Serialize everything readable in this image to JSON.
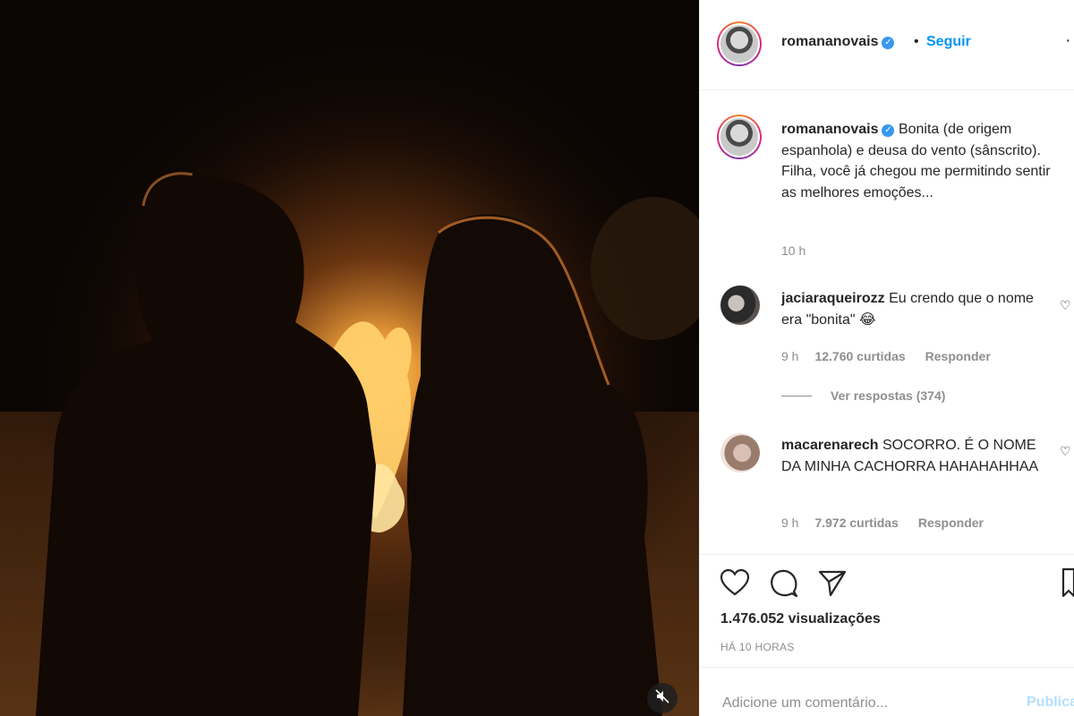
{
  "post": {
    "username": "romananovais",
    "follow_label": "Seguir",
    "separator": "•",
    "caption": "Bonita (de origem espanhola) e deusa do vento (sânscrito). Filha, você já chegou me permitindo sentir as melhores emoções...",
    "caption_time": "10 h",
    "views": "1.476.052 visualizações",
    "date": "HÁ 10 HORAS"
  },
  "comments": [
    {
      "username": "jaciaraqueirozz",
      "text": "Eu crendo que o nome era \"bonita\" 😂",
      "time": "9 h",
      "likes": "12.760 curtidas",
      "reply_label": "Responder"
    },
    {
      "username": "macarenarech",
      "text": "SOCORRO. É O NOME DA MINHA CACHORRA HAHAHAHHAA",
      "time": "9 h",
      "likes": "7.972 curtidas",
      "reply_label": "Responder"
    }
  ],
  "replies": {
    "label": "Ver respostas (374)"
  },
  "comment_box": {
    "placeholder": "Adicione um comentário...",
    "publish_label": "Publicar"
  },
  "icons": {
    "verified": "verified-badge-icon",
    "more": "more-options-icon",
    "like": "heart-icon",
    "comment": "comment-icon",
    "share": "paper-plane-icon",
    "save": "bookmark-icon",
    "mute": "muted-speaker-icon"
  },
  "colors": {
    "accent": "#0095f6",
    "verified": "#3897f0",
    "muted_text": "#8e8e8e",
    "publish_disabled": "#b2dffc"
  }
}
